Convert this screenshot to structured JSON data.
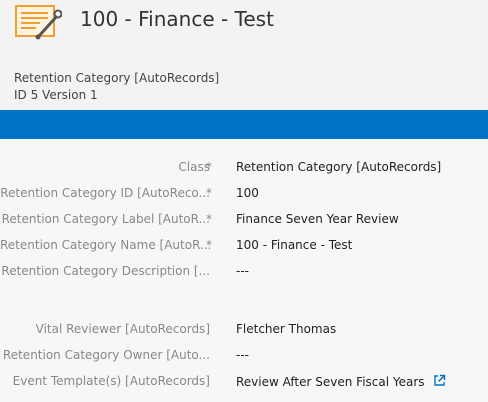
{
  "header": {
    "title": "100 - Finance - Test",
    "record_type": "Retention Category [AutoRecords]",
    "id_version": "ID 5  Version 1",
    "icon": "record-edit-icon"
  },
  "colors": {
    "accent": "#0072c6",
    "icon_orange": "#f0a030",
    "label_gray": "#888888"
  },
  "fields": [
    {
      "label": "Class",
      "required": "*",
      "value": "Retention Category  [AutoRecords]"
    },
    {
      "label": "Retention Category ID [AutoReco...",
      "required": "*",
      "value": "100"
    },
    {
      "label": "Retention Category Label [AutoR...",
      "required": "*",
      "value": "Finance Seven Year Review"
    },
    {
      "label": "Retention Category Name [AutoR...",
      "required": "*",
      "value": "100 - Finance - Test"
    },
    {
      "label": "Retention Category Description [...",
      "required": "",
      "value": "---"
    },
    {
      "label": "Vital Reviewer [AutoRecords]",
      "required": "",
      "value": "Fletcher Thomas"
    },
    {
      "label": "Retention Category Owner [Auto...",
      "required": "",
      "value": "---"
    },
    {
      "label": "Event Template(s) [AutoRecords]",
      "required": "",
      "value": "Review After Seven Fiscal Years",
      "link_icon": "external-link-icon"
    }
  ]
}
